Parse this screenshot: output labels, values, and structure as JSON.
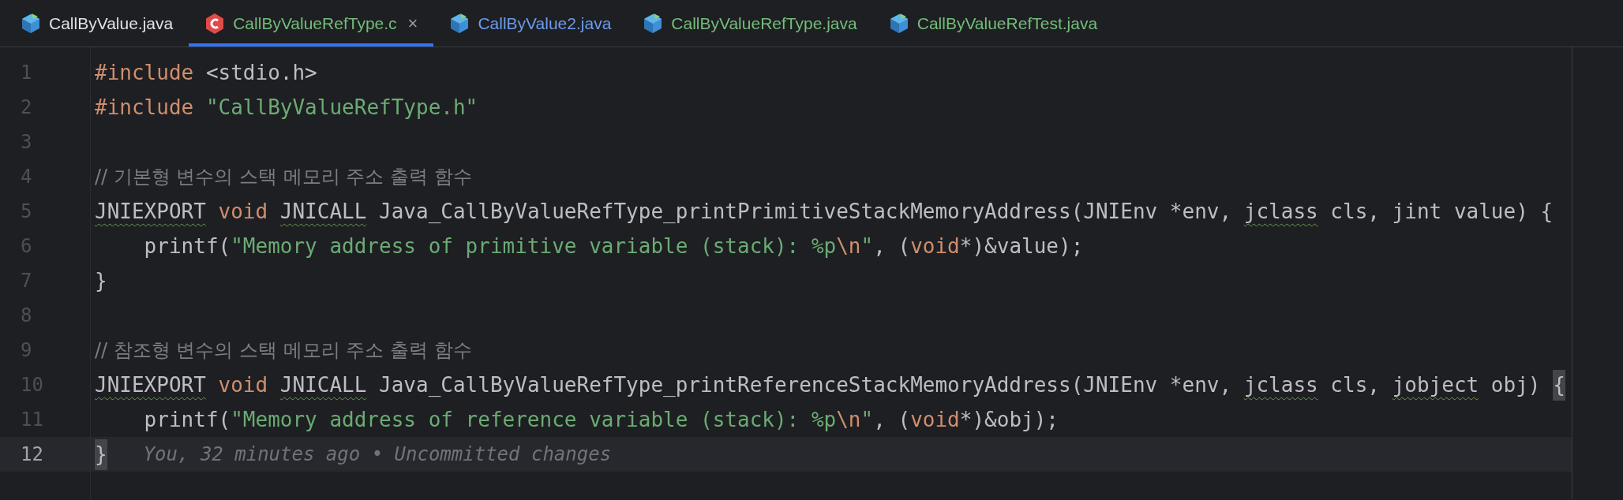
{
  "tabs": [
    {
      "label": "CallByValue.java",
      "kind": "java",
      "color": "#dfe1e5",
      "selected": false
    },
    {
      "label": "CallByValueRefType.c",
      "kind": "c",
      "color": "#73bd79",
      "selected": true,
      "close": "×"
    },
    {
      "label": "CallByValue2.java",
      "kind": "java",
      "color": "#6c9bf0",
      "selected": false
    },
    {
      "label": "CallByValueRefType.java",
      "kind": "java",
      "color": "#73bd79",
      "selected": false
    },
    {
      "label": "CallByValueRefTest.java",
      "kind": "java",
      "color": "#73bd79",
      "selected": false
    }
  ],
  "editor": {
    "lines": [
      {
        "number": "1",
        "current": false,
        "tokens": [
          {
            "kind": "keyword",
            "text": "#include"
          },
          {
            "kind": "plain",
            "text": " <stdio.h>"
          }
        ]
      },
      {
        "number": "2",
        "current": false,
        "tokens": [
          {
            "kind": "keyword",
            "text": "#include"
          },
          {
            "kind": "string",
            "text": " \"CallByValueRefType.h\""
          }
        ]
      },
      {
        "number": "3",
        "current": false
      },
      {
        "number": "4",
        "current": false,
        "tokens": [
          {
            "kind": "comment",
            "text": "// 기본형 변수의 스택 메모리 주소 출력 함수"
          }
        ]
      },
      {
        "number": "5",
        "current": false,
        "tokens": [
          {
            "kind": "warn",
            "text": "JNIEXPORT"
          },
          {
            "kind": "keyword",
            "text": " void "
          },
          {
            "kind": "warn",
            "text": "JNICALL"
          },
          {
            "kind": "plain",
            "text": " Java_CallByValueRefType_printPrimitiveStackMemoryAddress(JNIEnv *env, "
          },
          {
            "kind": "warn",
            "text": "jclass"
          },
          {
            "kind": "plain",
            "text": " cls, jint value) {"
          }
        ]
      },
      {
        "number": "6",
        "current": false,
        "tokens": [
          {
            "kind": "plain",
            "text": "    printf("
          },
          {
            "kind": "string",
            "text": "\"Memory address of primitive variable (stack): %p"
          },
          {
            "kind": "escape",
            "text": "\\n"
          },
          {
            "kind": "string",
            "text": "\""
          },
          {
            "kind": "plain",
            "text": ", ("
          },
          {
            "kind": "keyword",
            "text": "void"
          },
          {
            "kind": "plain",
            "text": "*)&value);"
          }
        ]
      },
      {
        "number": "7",
        "current": false,
        "tokens": [
          {
            "kind": "plain",
            "text": "}"
          }
        ]
      },
      {
        "number": "8",
        "current": false
      },
      {
        "number": "9",
        "current": false,
        "tokens": [
          {
            "kind": "comment",
            "text": "// 참조형 변수의 스택 메모리 주소 출력 함수"
          }
        ]
      },
      {
        "number": "10",
        "current": false,
        "tokens": [
          {
            "kind": "warn",
            "text": "JNIEXPORT"
          },
          {
            "kind": "keyword",
            "text": " void "
          },
          {
            "kind": "warn",
            "text": "JNICALL"
          },
          {
            "kind": "plain",
            "text": " Java_CallByValueRefType_printReferenceStackMemoryAddress(JNIEnv *env, "
          },
          {
            "kind": "warn",
            "text": "jclass"
          },
          {
            "kind": "plain",
            "text": " cls, "
          },
          {
            "kind": "warn",
            "text": "jobject"
          },
          {
            "kind": "plain",
            "text": " obj) "
          },
          {
            "kind": "brace-match",
            "text": "{"
          }
        ]
      },
      {
        "number": "11",
        "current": false,
        "tokens": [
          {
            "kind": "plain",
            "text": "    printf("
          },
          {
            "kind": "string",
            "text": "\"Memory address of reference variable (stack): %p"
          },
          {
            "kind": "escape",
            "text": "\\n"
          },
          {
            "kind": "string",
            "text": "\""
          },
          {
            "kind": "plain",
            "text": ", ("
          },
          {
            "kind": "keyword",
            "text": "void"
          },
          {
            "kind": "plain",
            "text": "*)&obj);"
          }
        ]
      },
      {
        "number": "12",
        "current": true,
        "tokens": [
          {
            "kind": "brace-match",
            "text": "}"
          }
        ],
        "hint": "You, 32 minutes ago • Uncommitted changes"
      }
    ]
  }
}
